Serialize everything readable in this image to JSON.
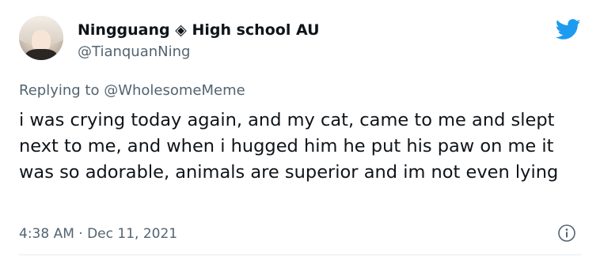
{
  "user": {
    "display_name": "Ningguang ◈ High school AU",
    "handle": "@TianquanNing"
  },
  "reply": {
    "prefix": "Replying to ",
    "mention": "@WholesomeMeme"
  },
  "tweet": {
    "text": "i was crying today again, and my cat, came to me and slept next to me, and when i hugged him he put his paw on me it was so adorable, animals are superior and im not even lying",
    "timestamp": "4:38 AM · Dec 11, 2021"
  },
  "icons": {
    "logo": "twitter-bird-icon",
    "info": "info-icon"
  },
  "colors": {
    "brand": "#1d9bf0",
    "secondary_text": "#536471",
    "primary_text": "#0f1419"
  }
}
